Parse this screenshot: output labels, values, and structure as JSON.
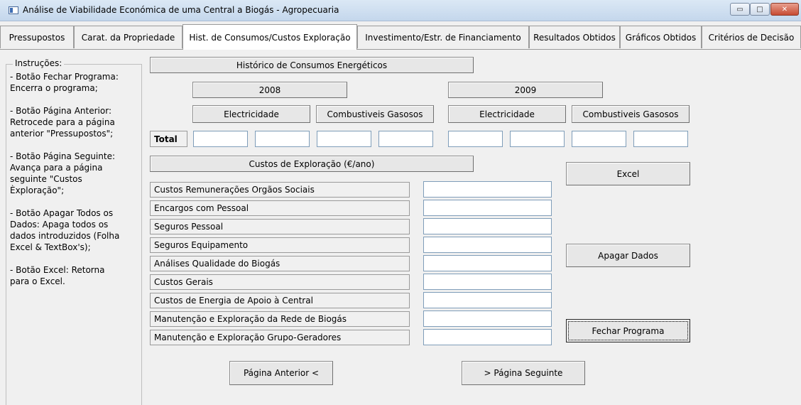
{
  "window": {
    "title": "Análise de Viabilidade Económica de uma Central a Biogás - Agropecuaria",
    "min_glyph": "▭",
    "max_glyph": "□",
    "close_glyph": "✕"
  },
  "tabs": [
    {
      "label": "Pressupostos",
      "active": false
    },
    {
      "label": "Carat. da Propriedade",
      "active": false
    },
    {
      "label": "Hist. de Consumos/Custos Exploração",
      "active": true
    },
    {
      "label": "Investimento/Estr. de Financiamento",
      "active": false
    },
    {
      "label": "Resultados Obtidos",
      "active": false
    },
    {
      "label": "Gráficos Obtidos",
      "active": false
    },
    {
      "label": "Critérios de Decisão",
      "active": false
    }
  ],
  "instructions": {
    "legend": "Instruções:",
    "text": "- Botão Fechar Programa:\nEncerra o programa;\n\n- Botão Página Anterior:\nRetrocede para a página\nanterior \"Pressupostos\";\n\n- Botão Página Seguinte:\nAvança para a página\nseguinte \"Custos\nÈxploração\";\n\n- Botão Apagar Todos os\nDados: Apaga todos os\ndados introduzidos (Folha\nExcel & TextBox's);\n\n- Botão Excel: Retorna\npara o Excel."
  },
  "history": {
    "header": "Histórico de Consumos Energéticos",
    "year1": "2008",
    "year2": "2009",
    "electricity": "Electricidade",
    "gas": "Combustiveis Gasosos",
    "total_label": "Total"
  },
  "costs": {
    "header": "Custos de Exploração (€/ano)",
    "rows": [
      "Custos Remunerações Orgãos Sociais",
      "Encargos com Pessoal",
      "Seguros Pessoal",
      "Seguros Equipamento",
      "Análises Qualidade do Biogás",
      "Custos Gerais",
      "Custos de Energia de Apoio à Central",
      "Manutenção e Exploração da Rede de Biogás",
      "Manutenção e Exploração Grupo-Geradores"
    ]
  },
  "buttons": {
    "excel": "Excel",
    "apagar": "Apagar Dados",
    "fechar": "Fechar Programa",
    "anterior": "Página Anterior <",
    "seguinte": "> Página Seguinte"
  }
}
